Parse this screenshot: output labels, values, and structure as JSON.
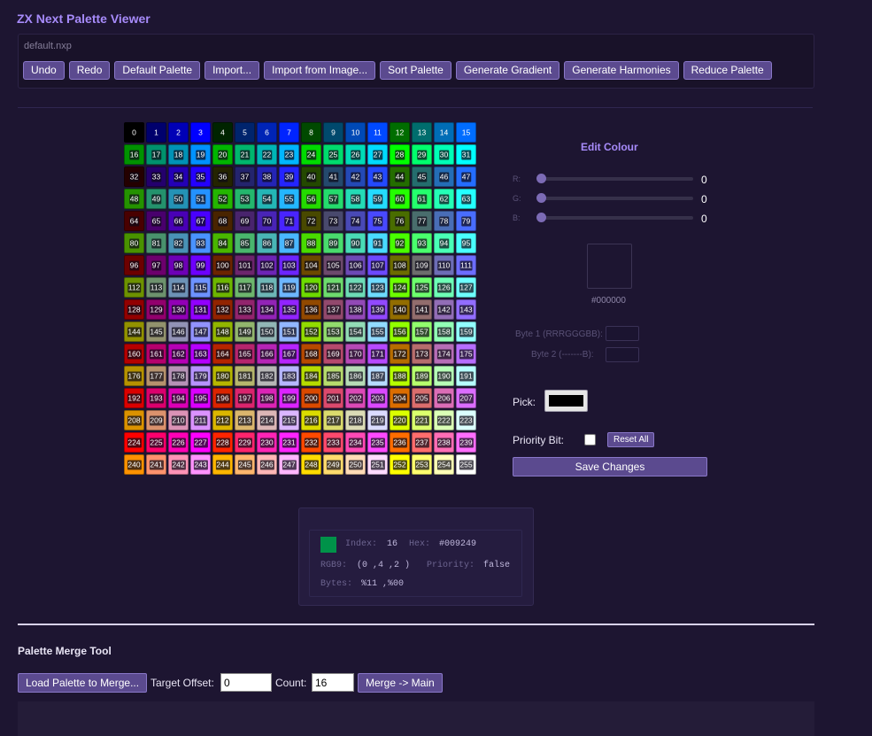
{
  "app": {
    "title": "ZX Next Palette Viewer"
  },
  "toolbar": {
    "filename": "default.nxp",
    "buttons": [
      {
        "label": "Undo"
      },
      {
        "label": "Redo"
      },
      {
        "label": "Default Palette"
      },
      {
        "label": "Import..."
      },
      {
        "label": "Import from Image..."
      },
      {
        "label": "Sort Palette"
      },
      {
        "label": "Generate Gradient"
      },
      {
        "label": "Generate Harmonies"
      },
      {
        "label": "Reduce Palette"
      }
    ]
  },
  "palette": {
    "count": 256,
    "selected_index": 0
  },
  "edit": {
    "title": "Edit Colour",
    "channels": [
      {
        "label": "R:",
        "value": "0"
      },
      {
        "label": "G:",
        "value": "0"
      },
      {
        "label": "B:",
        "value": "0"
      }
    ],
    "preview_hex": "#000000",
    "byte1_label": "Byte 1 (RRRGGGBB):",
    "byte2_label": "Byte 2 (-------B):",
    "pick_label": "Pick:",
    "pick_color": "#000000",
    "priority_label": "Priority Bit:",
    "priority_checked": false,
    "reset_all_label": "Reset All",
    "save_label": "Save Changes"
  },
  "info": {
    "swatch_color": "#009249",
    "index_label": "Index:",
    "index_value": "16",
    "hex_label": "Hex:",
    "hex_value": "#009249",
    "rgb9_label": "RGB9:",
    "rgb9_value": "(0 ,4 ,2 )",
    "priority_label": "Priority:",
    "priority_value": "false",
    "bytes_label": "Bytes:",
    "bytes_value": "%11 ,%00"
  },
  "merge": {
    "title": "Palette Merge Tool",
    "load_label": "Load Palette to Merge...",
    "offset_label": "Target Offset:",
    "offset_value": "0",
    "count_label": "Count:",
    "count_value": "16",
    "merge_label": "Merge -> Main"
  }
}
